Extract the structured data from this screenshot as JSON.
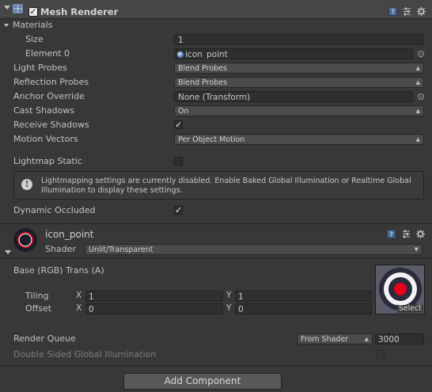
{
  "mesh_renderer": {
    "title": "Mesh Renderer",
    "enabled": true,
    "materials_label": "Materials",
    "size_label": "Size",
    "size_value": "1",
    "element0_label": "Element 0",
    "element0_value": "icon_point",
    "light_probes_label": "Light Probes",
    "light_probes_value": "Blend Probes",
    "reflection_probes_label": "Reflection Probes",
    "reflection_probes_value": "Blend Probes",
    "anchor_override_label": "Anchor Override",
    "anchor_override_value": "None (Transform)",
    "cast_shadows_label": "Cast Shadows",
    "cast_shadows_value": "On",
    "receive_shadows_label": "Receive Shadows",
    "receive_shadows_checked": true,
    "motion_vectors_label": "Motion Vectors",
    "motion_vectors_value": "Per Object Motion",
    "lightmap_static_label": "Lightmap Static",
    "lightmap_static_checked": false,
    "help_text": "Lightmapping settings are currently disabled. Enable Baked Global Illumination or Realtime Global Illumination to display these settings.",
    "dynamic_occluded_label": "Dynamic Occluded",
    "dynamic_occluded_checked": true
  },
  "material": {
    "name": "icon_point",
    "shader_label": "Shader",
    "shader_value": "Unlit/Transparent",
    "base_label": "Base (RGB) Trans (A)",
    "tiling_label": "Tiling",
    "offset_label": "Offset",
    "x_axis": "X",
    "y_axis": "Y",
    "tiling_x": "1",
    "tiling_y": "1",
    "offset_x": "0",
    "offset_y": "0",
    "select_label": "Select",
    "render_queue_label": "Render Queue",
    "render_queue_mode": "From Shader",
    "render_queue_value": "3000",
    "double_sided_label": "Double Sided Global Illumination",
    "double_sided_checked": false
  },
  "footer": {
    "add_component_label": "Add Component"
  },
  "icons": [
    "mesh-renderer-icon",
    "help-icon",
    "preset-icon",
    "gear-icon",
    "object-picker-icon",
    "popup-arrow-icon",
    "foldout-arrow-icon",
    "info-icon",
    "material-sphere-icon",
    "checkbox-check-icon"
  ],
  "colors": {
    "background": "#383838",
    "header": "#464646",
    "field": "#2f2f2f",
    "text": "#c2c2c2",
    "disabled_text": "#7e7e7e",
    "texture_red": "#e8001a"
  }
}
